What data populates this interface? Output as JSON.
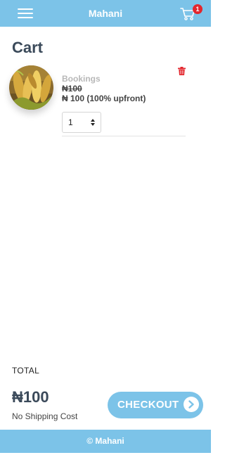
{
  "header": {
    "app_title": "Mahani",
    "cart_count": "1"
  },
  "page": {
    "title": "Cart"
  },
  "cart_item": {
    "category": "Bookings",
    "old_price": "₦100",
    "price_line": "₦ 100 (100% upfront)",
    "quantity": "1"
  },
  "summary": {
    "total_label": "TOTAL",
    "total_amount": "₦100",
    "shipping_note": "No Shipping Cost",
    "checkout_label": "CHECKOUT"
  },
  "footer": {
    "text": "© Mahani"
  },
  "colors": {
    "brand": "#7cc3e8",
    "badge": "#e3262d",
    "heading": "#3b4a5a"
  },
  "icons": {
    "menu": "hamburger-menu-icon",
    "cart": "shopping-cart-icon",
    "delete": "trash-icon",
    "quantity": "select-arrows-icon",
    "checkout": "chevron-right-icon"
  }
}
